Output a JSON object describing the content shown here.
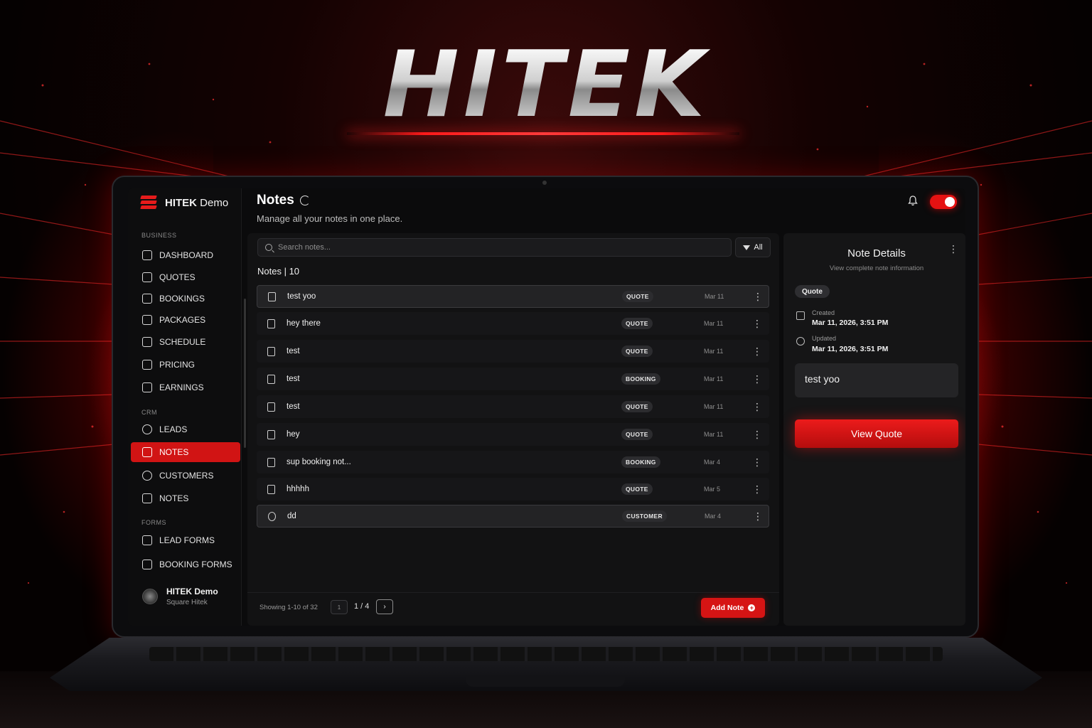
{
  "brand": {
    "logo_text": "HITEK"
  },
  "sidebar": {
    "brand_name": "HITEK",
    "brand_suffix": "Demo",
    "sections": {
      "business": "BUSINESS",
      "crm": "CRM",
      "forms": "FORMS"
    },
    "items": [
      {
        "label": "DASHBOARD",
        "icon": "dashboard-icon"
      },
      {
        "label": "QUOTES",
        "icon": "quote-icon"
      },
      {
        "label": "BOOKINGS",
        "icon": "calendar-icon"
      },
      {
        "label": "PACKAGES",
        "icon": "package-icon"
      },
      {
        "label": "SCHEDULE",
        "icon": "schedule-icon"
      },
      {
        "label": "PRICING",
        "icon": "pricing-icon"
      },
      {
        "label": "EARNINGS",
        "icon": "earnings-icon"
      },
      {
        "label": "LEADS",
        "icon": "user-icon"
      },
      {
        "label": "NOTES",
        "icon": "note-icon",
        "active": true
      },
      {
        "label": "CUSTOMERS",
        "icon": "users-icon"
      },
      {
        "label": "NOTES",
        "icon": "note-icon"
      },
      {
        "label": "LEAD FORMS",
        "icon": "clipboard-icon"
      },
      {
        "label": "BOOKING FORMS",
        "icon": "form-icon"
      }
    ],
    "user": {
      "name": "HITEK Demo",
      "subtitle": "Square Hitek"
    }
  },
  "header": {
    "title": "Notes",
    "subtitle": "Manage all your notes in one place."
  },
  "notes": {
    "search_placeholder": "Search notes...",
    "filter_label": "All",
    "count_label": "Notes |",
    "count": "10",
    "rows": [
      {
        "title": "test yoo",
        "type": "QUOTE",
        "date": "Mar 11",
        "icon": "quote-icon"
      },
      {
        "title": "hey there",
        "type": "QUOTE",
        "date": "Mar 11",
        "icon": "quote-icon"
      },
      {
        "title": "test",
        "type": "QUOTE",
        "date": "Mar 11",
        "icon": "quote-icon"
      },
      {
        "title": "test",
        "type": "BOOKING",
        "date": "Mar 11",
        "icon": "quote-icon"
      },
      {
        "title": "test",
        "type": "QUOTE",
        "date": "Mar 11",
        "icon": "quote-icon"
      },
      {
        "title": "hey",
        "type": "QUOTE",
        "date": "Mar 11",
        "icon": "document-icon"
      },
      {
        "title": "sup booking not...",
        "type": "BOOKING",
        "date": "Mar 4",
        "icon": "calendar-icon"
      },
      {
        "title": "hhhhh",
        "type": "QUOTE",
        "date": "Mar 5",
        "icon": "quote-icon"
      },
      {
        "title": "dd",
        "type": "CUSTOMER",
        "date": "Mar 4",
        "icon": "user-icon"
      }
    ],
    "showing": "Showing 1-10 of 32",
    "page_input": "1",
    "page_indicator": "1 / 4",
    "next_label": "›",
    "add_label": "Add Note"
  },
  "details": {
    "title": "Note Details",
    "subtitle": "View complete note information",
    "badge": "Quote",
    "created_label": "Created",
    "created_value": "Mar 11, 2026, 3:51 PM",
    "updated_label": "Updated",
    "updated_value": "Mar 11, 2026, 3:51 PM",
    "content": "test yoo",
    "action_label": "View Quote"
  },
  "colors": {
    "accent": "#d61414",
    "background": "#0b0b0c"
  }
}
